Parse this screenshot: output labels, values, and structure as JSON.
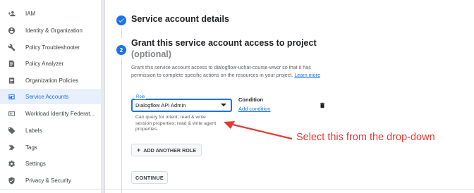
{
  "sidebar": {
    "items": [
      {
        "label": "IAM",
        "icon": "person-add-icon",
        "active": false
      },
      {
        "label": "Identity & Organization",
        "icon": "account-circle-icon",
        "active": false
      },
      {
        "label": "Policy Troubleshooter",
        "icon": "wrench-icon",
        "active": false
      },
      {
        "label": "Policy Analyzer",
        "icon": "document-search-icon",
        "active": false
      },
      {
        "label": "Organization Policies",
        "icon": "list-document-icon",
        "active": false
      },
      {
        "label": "Service Accounts",
        "icon": "service-account-icon",
        "active": true
      },
      {
        "label": "Workload Identity Federat...",
        "icon": "id-card-icon",
        "active": false
      },
      {
        "label": "Labels",
        "icon": "label-icon",
        "active": false
      },
      {
        "label": "Tags",
        "icon": "tag-arrow-icon",
        "active": false
      },
      {
        "label": "Settings",
        "icon": "gear-icon",
        "active": false
      },
      {
        "label": "Privacy & Security",
        "icon": "shield-icon",
        "active": false
      }
    ]
  },
  "steps": {
    "step1": {
      "title": "Service account details",
      "status": "completed"
    },
    "step2": {
      "number": "2",
      "title": "Grant this service account access to project",
      "subtitle": "(optional)",
      "description": "Grant this service account access to dialogflow-uchat-course-wwcr so that it has permission to complete specific actions on the resources in your project.",
      "learn_more": "Learn more"
    }
  },
  "role": {
    "label": "Role",
    "value": "Dialogflow API Admin",
    "help": "Can query for intent; read & write session properties; read & write agent properties."
  },
  "condition": {
    "title": "Condition",
    "add_link": "Add condition"
  },
  "buttons": {
    "add_role": "ADD ANOTHER ROLE",
    "continue": "CONTINUE"
  },
  "annotation": {
    "text": "Select this from the drop-down",
    "color": "#e53935"
  },
  "colors": {
    "accent": "#1a73e8",
    "active_bg": "#e8f0fe"
  }
}
